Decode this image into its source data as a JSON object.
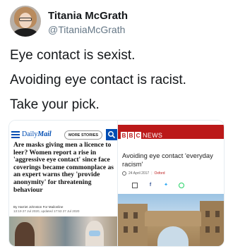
{
  "tweet": {
    "author_name": "Titania McGrath",
    "author_handle": "@TitaniaMcGrath",
    "lines": [
      "Eye contact is sexist.",
      "Avoiding eye contact is racist.",
      "Take your pick."
    ]
  },
  "daily_mail": {
    "logo_prefix": "Daily",
    "logo_main": "Mail",
    "more_stories_label": "MORE STORIES",
    "headline": "Are masks giving men a licence to leer? Women report a rise in 'aggressive eye contact' since face coverings became commonplace as an expert warns they 'provide anonymity' for threatening behaviour",
    "byline": "By Harriet Johnston For Mailonline",
    "date": "13:19 27 Jul 2020, updated 17:53 27 Jul 2020",
    "brand_color": "#004db3"
  },
  "bbc": {
    "blocks": [
      "B",
      "B",
      "C"
    ],
    "news_label": "NEWS",
    "headline": "Avoiding eye contact 'everyday racism'",
    "date": "24 April 2017",
    "tag": "Oxford",
    "share_icons": [
      "mail-icon",
      "facebook-icon",
      "twitter-icon",
      "whatsapp-icon"
    ],
    "brand_color": "#bb1919"
  }
}
